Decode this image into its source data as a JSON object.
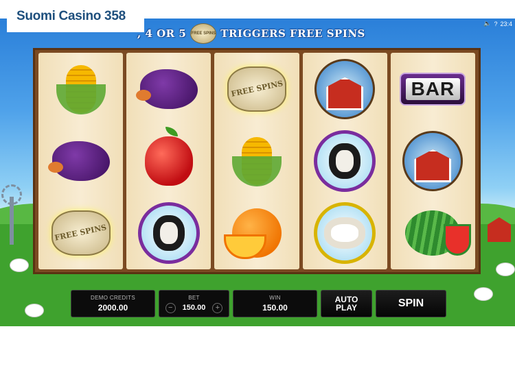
{
  "site_logo": "Suomi Casino 358",
  "banner": {
    "text_left": ", 4 OR 5",
    "coin_label": "FREE SPINS",
    "text_right": "TRIGGERS FREE SPINS"
  },
  "tray": {
    "help": "?",
    "time": "23:4"
  },
  "reels": [
    [
      {
        "symbol": "corn"
      },
      {
        "symbol": "eggplant"
      },
      {
        "symbol": "free-spins-bag",
        "label": "FREE SPINS"
      }
    ],
    [
      {
        "symbol": "eggplant"
      },
      {
        "symbol": "apple"
      },
      {
        "symbol": "black-sheep"
      }
    ],
    [
      {
        "symbol": "free-spins-bag",
        "label": "FREE SPINS"
      },
      {
        "symbol": "corn"
      },
      {
        "symbol": "orange"
      }
    ],
    [
      {
        "symbol": "barn"
      },
      {
        "symbol": "black-sheep"
      },
      {
        "symbol": "white-sheep"
      }
    ],
    [
      {
        "symbol": "bar",
        "label": "BAR"
      },
      {
        "symbol": "barn"
      },
      {
        "symbol": "watermelon"
      }
    ]
  ],
  "controls": {
    "credits_label": "DEMO CREDITS",
    "credits_value": "2000.00",
    "bet_label": "BET",
    "bet_value": "150.00",
    "bet_minus": "−",
    "bet_plus": "+",
    "win_label": "WIN",
    "win_value": "150.00",
    "autoplay_label_1": "AUTO",
    "autoplay_label_2": "PLAY",
    "spin_label": "SPIN"
  }
}
